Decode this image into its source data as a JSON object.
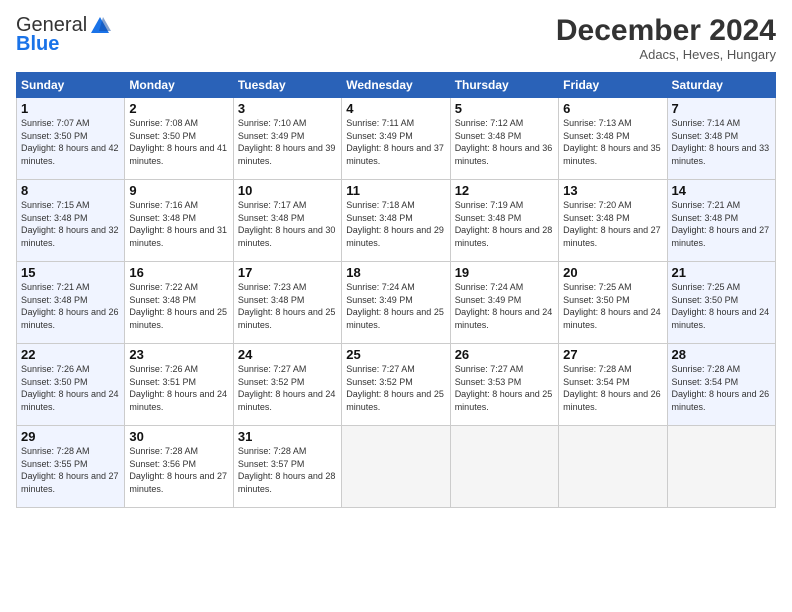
{
  "header": {
    "logo_general": "General",
    "logo_blue": "Blue",
    "month_title": "December 2024",
    "subtitle": "Adacs, Heves, Hungary"
  },
  "weekdays": [
    "Sunday",
    "Monday",
    "Tuesday",
    "Wednesday",
    "Thursday",
    "Friday",
    "Saturday"
  ],
  "weeks": [
    [
      {
        "day": 1,
        "sunrise": "7:07 AM",
        "sunset": "3:50 PM",
        "daylight": "8 hours and 42 minutes.",
        "weekend": true
      },
      {
        "day": 2,
        "sunrise": "7:08 AM",
        "sunset": "3:50 PM",
        "daylight": "8 hours and 41 minutes.",
        "weekend": false
      },
      {
        "day": 3,
        "sunrise": "7:10 AM",
        "sunset": "3:49 PM",
        "daylight": "8 hours and 39 minutes.",
        "weekend": false
      },
      {
        "day": 4,
        "sunrise": "7:11 AM",
        "sunset": "3:49 PM",
        "daylight": "8 hours and 37 minutes.",
        "weekend": false
      },
      {
        "day": 5,
        "sunrise": "7:12 AM",
        "sunset": "3:48 PM",
        "daylight": "8 hours and 36 minutes.",
        "weekend": false
      },
      {
        "day": 6,
        "sunrise": "7:13 AM",
        "sunset": "3:48 PM",
        "daylight": "8 hours and 35 minutes.",
        "weekend": false
      },
      {
        "day": 7,
        "sunrise": "7:14 AM",
        "sunset": "3:48 PM",
        "daylight": "8 hours and 33 minutes.",
        "weekend": true
      }
    ],
    [
      {
        "day": 8,
        "sunrise": "7:15 AM",
        "sunset": "3:48 PM",
        "daylight": "8 hours and 32 minutes.",
        "weekend": true
      },
      {
        "day": 9,
        "sunrise": "7:16 AM",
        "sunset": "3:48 PM",
        "daylight": "8 hours and 31 minutes.",
        "weekend": false
      },
      {
        "day": 10,
        "sunrise": "7:17 AM",
        "sunset": "3:48 PM",
        "daylight": "8 hours and 30 minutes.",
        "weekend": false
      },
      {
        "day": 11,
        "sunrise": "7:18 AM",
        "sunset": "3:48 PM",
        "daylight": "8 hours and 29 minutes.",
        "weekend": false
      },
      {
        "day": 12,
        "sunrise": "7:19 AM",
        "sunset": "3:48 PM",
        "daylight": "8 hours and 28 minutes.",
        "weekend": false
      },
      {
        "day": 13,
        "sunrise": "7:20 AM",
        "sunset": "3:48 PM",
        "daylight": "8 hours and 27 minutes.",
        "weekend": false
      },
      {
        "day": 14,
        "sunrise": "7:21 AM",
        "sunset": "3:48 PM",
        "daylight": "8 hours and 27 minutes.",
        "weekend": true
      }
    ],
    [
      {
        "day": 15,
        "sunrise": "7:21 AM",
        "sunset": "3:48 PM",
        "daylight": "8 hours and 26 minutes.",
        "weekend": true
      },
      {
        "day": 16,
        "sunrise": "7:22 AM",
        "sunset": "3:48 PM",
        "daylight": "8 hours and 25 minutes.",
        "weekend": false
      },
      {
        "day": 17,
        "sunrise": "7:23 AM",
        "sunset": "3:48 PM",
        "daylight": "8 hours and 25 minutes.",
        "weekend": false
      },
      {
        "day": 18,
        "sunrise": "7:24 AM",
        "sunset": "3:49 PM",
        "daylight": "8 hours and 25 minutes.",
        "weekend": false
      },
      {
        "day": 19,
        "sunrise": "7:24 AM",
        "sunset": "3:49 PM",
        "daylight": "8 hours and 24 minutes.",
        "weekend": false
      },
      {
        "day": 20,
        "sunrise": "7:25 AM",
        "sunset": "3:50 PM",
        "daylight": "8 hours and 24 minutes.",
        "weekend": false
      },
      {
        "day": 21,
        "sunrise": "7:25 AM",
        "sunset": "3:50 PM",
        "daylight": "8 hours and 24 minutes.",
        "weekend": true
      }
    ],
    [
      {
        "day": 22,
        "sunrise": "7:26 AM",
        "sunset": "3:50 PM",
        "daylight": "8 hours and 24 minutes.",
        "weekend": true
      },
      {
        "day": 23,
        "sunrise": "7:26 AM",
        "sunset": "3:51 PM",
        "daylight": "8 hours and 24 minutes.",
        "weekend": false
      },
      {
        "day": 24,
        "sunrise": "7:27 AM",
        "sunset": "3:52 PM",
        "daylight": "8 hours and 24 minutes.",
        "weekend": false
      },
      {
        "day": 25,
        "sunrise": "7:27 AM",
        "sunset": "3:52 PM",
        "daylight": "8 hours and 25 minutes.",
        "weekend": false
      },
      {
        "day": 26,
        "sunrise": "7:27 AM",
        "sunset": "3:53 PM",
        "daylight": "8 hours and 25 minutes.",
        "weekend": false
      },
      {
        "day": 27,
        "sunrise": "7:28 AM",
        "sunset": "3:54 PM",
        "daylight": "8 hours and 26 minutes.",
        "weekend": false
      },
      {
        "day": 28,
        "sunrise": "7:28 AM",
        "sunset": "3:54 PM",
        "daylight": "8 hours and 26 minutes.",
        "weekend": true
      }
    ],
    [
      {
        "day": 29,
        "sunrise": "7:28 AM",
        "sunset": "3:55 PM",
        "daylight": "8 hours and 27 minutes.",
        "weekend": true
      },
      {
        "day": 30,
        "sunrise": "7:28 AM",
        "sunset": "3:56 PM",
        "daylight": "8 hours and 27 minutes.",
        "weekend": false
      },
      {
        "day": 31,
        "sunrise": "7:28 AM",
        "sunset": "3:57 PM",
        "daylight": "8 hours and 28 minutes.",
        "weekend": false
      },
      null,
      null,
      null,
      null
    ]
  ]
}
